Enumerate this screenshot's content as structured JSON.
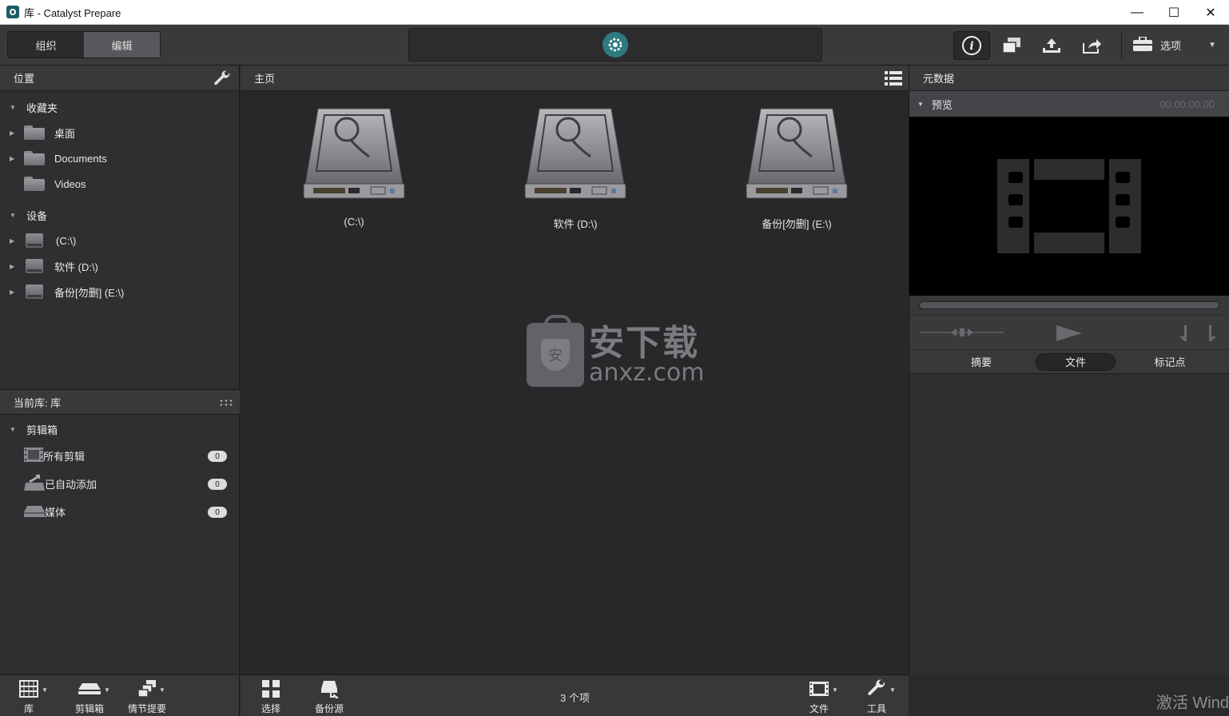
{
  "window": {
    "title": "库 - Catalyst Prepare",
    "controls": {
      "minimize": "—",
      "maximize": "☐",
      "close": "✕"
    }
  },
  "toolbar": {
    "mode_tabs": [
      {
        "label": "组织",
        "active": false
      },
      {
        "label": "编辑",
        "active": true
      }
    ],
    "options_label": "选项",
    "icons": [
      "info-icon",
      "copy-windows-icon",
      "upload-icon",
      "share-icon",
      "toolbox-icon"
    ]
  },
  "left_panel": {
    "header": "位置",
    "favorites": {
      "label": "收藏夹",
      "items": [
        {
          "label": "桌面"
        },
        {
          "label": "Documents"
        },
        {
          "label": "Videos"
        }
      ]
    },
    "devices": {
      "label": "设备",
      "items": [
        {
          "label": "(C:\\)"
        },
        {
          "label": "软件 (D:\\)"
        },
        {
          "label": "备份[勿删] (E:\\)"
        }
      ]
    },
    "library_header": "当前库: 库",
    "clipbin": {
      "label": "剪辑箱",
      "items": [
        {
          "label": "所有剪辑",
          "count": "0"
        },
        {
          "label": "已自动添加",
          "count": "0"
        },
        {
          "label": "媒体",
          "count": "0"
        }
      ]
    },
    "bottom_buttons": [
      {
        "label": "库"
      },
      {
        "label": "剪辑箱"
      },
      {
        "label": "情节提要"
      }
    ]
  },
  "main_panel": {
    "header": "主页",
    "drives": [
      {
        "label": "(C:\\)"
      },
      {
        "label": "软件 (D:\\)"
      },
      {
        "label": "备份[勿删] (E:\\)"
      }
    ],
    "watermark": {
      "cn": "安下载",
      "en": "anxz.com",
      "shield": "安"
    },
    "bottom_buttons": [
      {
        "label": "选择"
      },
      {
        "label": "备份源"
      },
      {
        "label": "文件"
      },
      {
        "label": "工具"
      }
    ],
    "item_count": "3 个项"
  },
  "right_panel": {
    "header": "元数据",
    "preview_label": "预览",
    "timecode": "00:00:00:00",
    "tabs": [
      {
        "label": "摘要",
        "active": false
      },
      {
        "label": "文件",
        "active": true
      },
      {
        "label": "标记点",
        "active": false
      }
    ]
  },
  "activation_watermark": "激活 Wind"
}
